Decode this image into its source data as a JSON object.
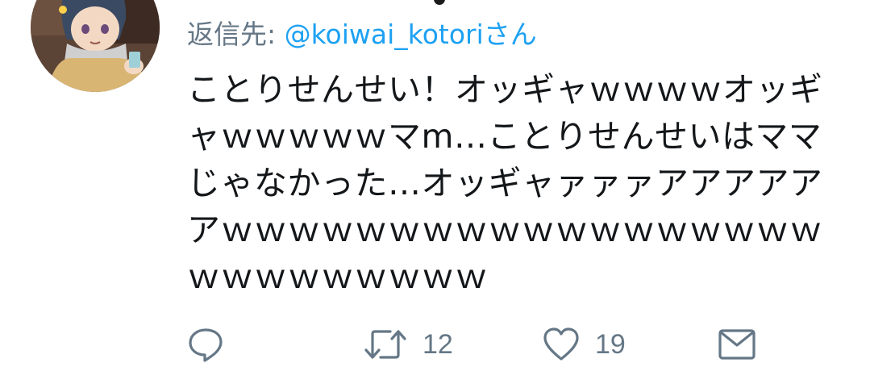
{
  "reply": {
    "prefix": "返信先: ",
    "handle": "@koiwai_kotoriさん"
  },
  "tweet": {
    "text": "ことりせんせい！オッギャｗｗｗｗオッギャｗｗｗｗｗマm…ことりせんせいはママじゃなかった…オッギャァァァアアアアアアｗｗｗｗｗｗｗｗｗｗｗｗｗｗｗｗｗｗｗｗｗｗｗｗｗｗｗ"
  },
  "actions": {
    "reply": {
      "icon": "speech-bubble-icon"
    },
    "retweet": {
      "icon": "retweet-icon",
      "count": "12"
    },
    "like": {
      "icon": "heart-icon",
      "count": "19"
    },
    "dm": {
      "icon": "envelope-icon"
    }
  },
  "colors": {
    "text": "#14171a",
    "secondary": "#657786",
    "link": "#1da1f2"
  }
}
